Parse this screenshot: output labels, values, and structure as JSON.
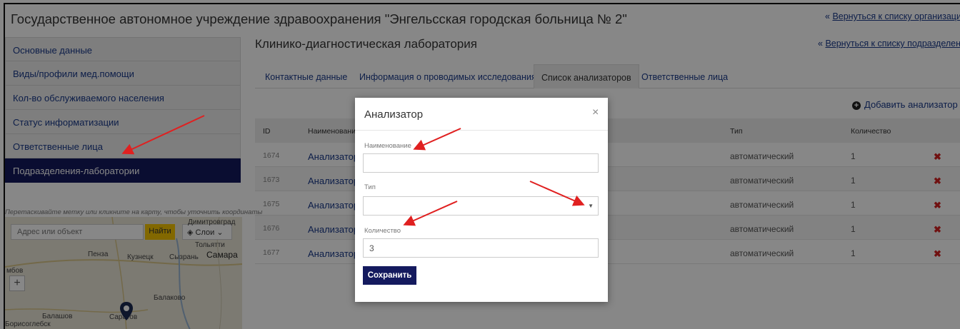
{
  "header": {
    "org_title": "Государственное автономное учреждение здравоохранения \"Энгельсская городская больница № 2\"",
    "back_to_orgs": "Вернуться к списку организаций",
    "back_to_subs": "Вернуться к списку подразделений",
    "back_prefix": "«"
  },
  "sidebar": {
    "items": [
      {
        "label": "Основные данные"
      },
      {
        "label": "Виды/профили мед.помощи"
      },
      {
        "label": "Кол-во обслуживаемого населения"
      },
      {
        "label": "Статус информатизации"
      },
      {
        "label": "Ответственные лица"
      },
      {
        "label": "Подразделения-лаборатории",
        "active": true
      }
    ]
  },
  "map": {
    "hint": "Перетаскивайте метку или кликните на карту, чтобы уточнить координаты",
    "search_placeholder": "Адрес или объект",
    "find_label": "Найти",
    "layers_label": "Слои",
    "zoom_in": "+",
    "cities": [
      "Димитровград",
      "Тольятти",
      "Пенза",
      "Кузнецк",
      "Сызрань",
      "Самара",
      "мбов",
      "Балаково",
      "Балашов",
      "Саратов",
      "Борисоглебск"
    ]
  },
  "main": {
    "title": "Клинико-диагностическая лаборатория",
    "tabs": [
      {
        "label": "Контактные данные"
      },
      {
        "label": "Информация о проводимых исследованиях"
      },
      {
        "label": "Список анализаторов",
        "active": true
      },
      {
        "label": "Ответственные лица"
      }
    ],
    "add_label": "Добавить анализатор",
    "table": {
      "headers": {
        "id": "ID",
        "name": "Наименование",
        "type": "Тип",
        "qty": "Количество"
      },
      "rows": [
        {
          "id": "1674",
          "name": "Анализатор г",
          "type": "автоматический",
          "qty": "1"
        },
        {
          "id": "1673",
          "name": "Анализатор г",
          "type": "автоматический",
          "qty": "1"
        },
        {
          "id": "1675",
          "name": "Анализатор г",
          "type": "автоматический",
          "qty": "1"
        },
        {
          "id": "1676",
          "name": "Анализатор б",
          "type": "автоматический",
          "qty": "1"
        },
        {
          "id": "1677",
          "name": "Анализатор б",
          "type": "автоматический",
          "qty": "1"
        }
      ],
      "delete_glyph": "✖"
    }
  },
  "modal": {
    "title": "Анализатор",
    "close": "×",
    "name_label": "Наименование",
    "name_value": "",
    "type_label": "Тип",
    "type_value": "",
    "qty_label": "Количество",
    "qty_value": "3",
    "save_label": "Сохранить"
  },
  "colors": {
    "accent": "#141a5e",
    "link": "#1a3a8a",
    "annotation_arrow": "#e02020",
    "delete": "#d32020",
    "map_button": "#f5c400"
  }
}
